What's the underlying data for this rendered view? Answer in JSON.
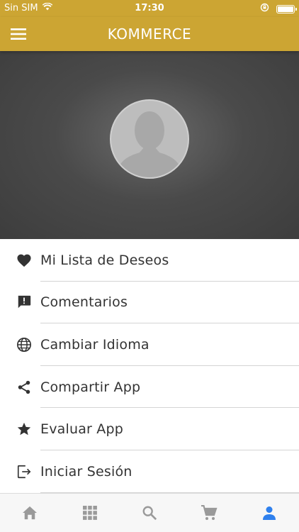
{
  "status_bar": {
    "carrier": "Sin SIM",
    "time": "17:30"
  },
  "toolbar": {
    "title": "KOMMERCE"
  },
  "menu": {
    "items": [
      {
        "label": "Mi Lista de Deseos",
        "icon": "heart-icon"
      },
      {
        "label": "Comentarios",
        "icon": "feedback-icon"
      },
      {
        "label": "Cambiar Idioma",
        "icon": "globe-icon"
      },
      {
        "label": "Compartir App",
        "icon": "share-icon"
      },
      {
        "label": "Evaluar App",
        "icon": "star-icon"
      },
      {
        "label": "Iniciar Sesión",
        "icon": "login-icon"
      }
    ]
  },
  "bottom_nav": {
    "tabs": [
      "home-icon",
      "categories-icon",
      "search-icon",
      "cart-icon",
      "profile-icon"
    ],
    "active": "profile-icon"
  },
  "colors": {
    "accent": "#cca533",
    "header_bg": "#4a4a4a",
    "active_tab": "#2f80ed",
    "inactive_tab": "#9a9a9a"
  }
}
